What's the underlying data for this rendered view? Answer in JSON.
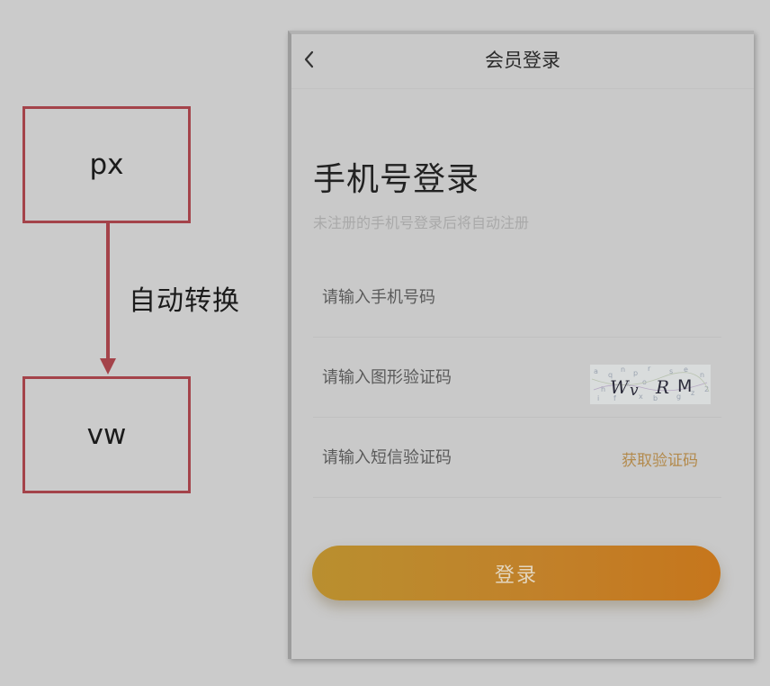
{
  "diagram": {
    "source_label": "px",
    "target_label": "vw",
    "arrow_label": "自动转换",
    "border_color": "#a4434a"
  },
  "phone": {
    "nav_title": "会员登录",
    "back_icon": "chevron-left-icon",
    "title": "手机号登录",
    "subtitle": "未注册的手机号登录后将自动注册",
    "phone_field": {
      "placeholder": "请输入手机号码",
      "value": ""
    },
    "captcha_field": {
      "placeholder": "请输入图形验证码",
      "value": ""
    },
    "captcha_text": "WvRM",
    "sms_field": {
      "placeholder": "请输入短信验证码",
      "value": ""
    },
    "sms_button_label": "获取验证码",
    "login_button_label": "登录",
    "accent_color": "#c1812a"
  }
}
